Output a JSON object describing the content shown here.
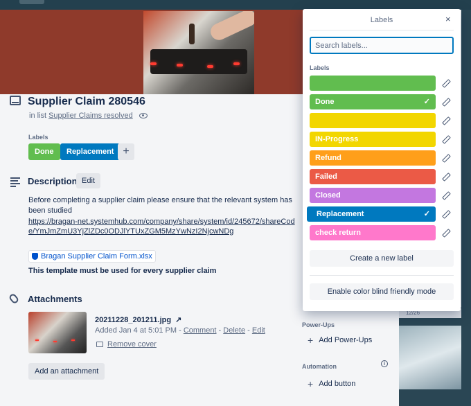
{
  "card": {
    "title": "Supplier Claim 280546",
    "in_list_prefix": "in list",
    "list_name": "Supplier Claims resolved",
    "labels_heading": "Labels",
    "labels": [
      {
        "name": "Done",
        "color": "#61bd4f"
      },
      {
        "name": "Replacement",
        "color": "#0079bf"
      }
    ],
    "add_label": "+"
  },
  "description": {
    "title": "Description",
    "edit_label": "Edit",
    "text": "Before completing a supplier claim please ensure that the relevant system has been studied",
    "link": "https://bragan-net.systemhub.com/company/share/system/id/245672/shareCode/YmJmZmU3YjZlZDc0ODJlYTUxZGM5MzYwNzI2NjcwNDg",
    "file_link": "Bragan Supplier Claim Form.xlsx",
    "note": "This template must be used for every supplier claim"
  },
  "attachments": {
    "title": "Attachments",
    "file_name": "20211228_201211.jpg",
    "arrow": "↗",
    "added": "Added Jan 4 at 5:01 PM - ",
    "comment": "Comment",
    "delete": "Delete",
    "edit": "Edit",
    "sep": " - ",
    "remove_cover": "Remove cover",
    "add_button": "Add an attachment"
  },
  "sidebar": {
    "powerups_heading": "Power-Ups",
    "add_powerups": "Add Power-Ups",
    "automation_heading": "Automation",
    "add_button": "Add button"
  },
  "background": {
    "card_date": "12/26"
  },
  "popover": {
    "title": "Labels",
    "close": "×",
    "search_placeholder": "Search labels...",
    "labels_heading": "Labels",
    "labels": [
      {
        "name": "",
        "color": "#61bd4f",
        "selected": false
      },
      {
        "name": "Done",
        "color": "#61bd4f",
        "selected": true
      },
      {
        "name": "",
        "color": "#f2d600",
        "selected": false
      },
      {
        "name": "IN-Progress",
        "color": "#f2d600",
        "selected": false
      },
      {
        "name": "Refund",
        "color": "#ff9f1a",
        "selected": false
      },
      {
        "name": "Failed",
        "color": "#eb5a46",
        "selected": false
      },
      {
        "name": "Closed",
        "color": "#c377e0",
        "selected": false
      },
      {
        "name": "Replacement",
        "color": "#0079bf",
        "selected": true
      },
      {
        "name": "check return",
        "color": "#ff78cb",
        "selected": false
      }
    ],
    "create_label": "Create a new label",
    "colorblind_mode": "Enable color blind friendly mode"
  }
}
